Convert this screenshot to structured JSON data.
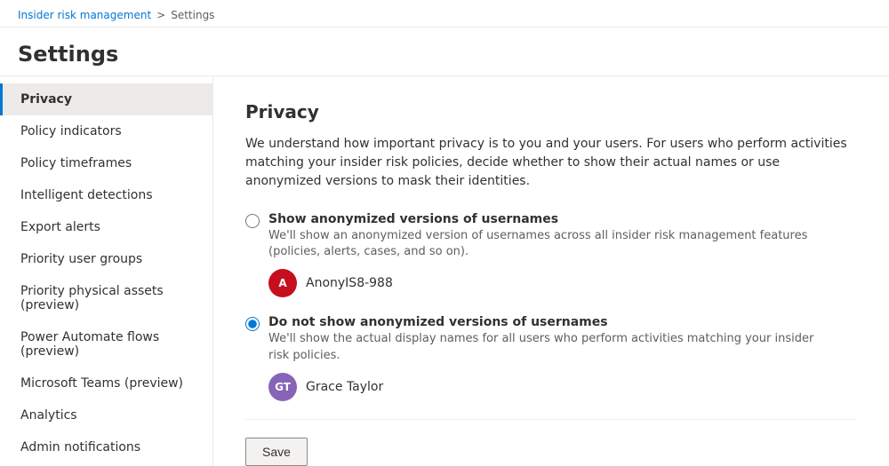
{
  "breadcrumb": {
    "parent": "Insider risk management",
    "separator": ">",
    "current": "Settings"
  },
  "page": {
    "title": "Settings"
  },
  "sidebar": {
    "items": [
      {
        "id": "privacy",
        "label": "Privacy",
        "active": true
      },
      {
        "id": "policy-indicators",
        "label": "Policy indicators",
        "active": false
      },
      {
        "id": "policy-timeframes",
        "label": "Policy timeframes",
        "active": false
      },
      {
        "id": "intelligent-detections",
        "label": "Intelligent detections",
        "active": false
      },
      {
        "id": "export-alerts",
        "label": "Export alerts",
        "active": false
      },
      {
        "id": "priority-user-groups",
        "label": "Priority user groups",
        "active": false
      },
      {
        "id": "priority-physical-assets",
        "label": "Priority physical assets (preview)",
        "active": false
      },
      {
        "id": "power-automate-flows",
        "label": "Power Automate flows (preview)",
        "active": false
      },
      {
        "id": "microsoft-teams",
        "label": "Microsoft Teams (preview)",
        "active": false
      },
      {
        "id": "analytics",
        "label": "Analytics",
        "active": false
      },
      {
        "id": "admin-notifications",
        "label": "Admin notifications",
        "active": false
      }
    ]
  },
  "content": {
    "title": "Privacy",
    "description": "We understand how important privacy is to you and your users. For users who perform activities matching your insider risk policies, decide whether to show their actual names or use anonymized versions to mask their identities.",
    "options": [
      {
        "id": "anonymized",
        "label": "Show anonymized versions of usernames",
        "description": "We'll show an anonymized version of usernames across all insider risk management features (policies, alerts, cases, and so on).",
        "checked": false,
        "example_user": {
          "initials": "A",
          "name": "AnonyIS8-988",
          "avatar_color": "red"
        }
      },
      {
        "id": "actual",
        "label": "Do not show anonymized versions of usernames",
        "description": "We'll show the actual display names for all users who perform activities matching your insider risk policies.",
        "checked": true,
        "example_user": {
          "initials": "GT",
          "name": "Grace Taylor",
          "avatar_color": "purple"
        }
      }
    ],
    "save_button": "Save"
  }
}
